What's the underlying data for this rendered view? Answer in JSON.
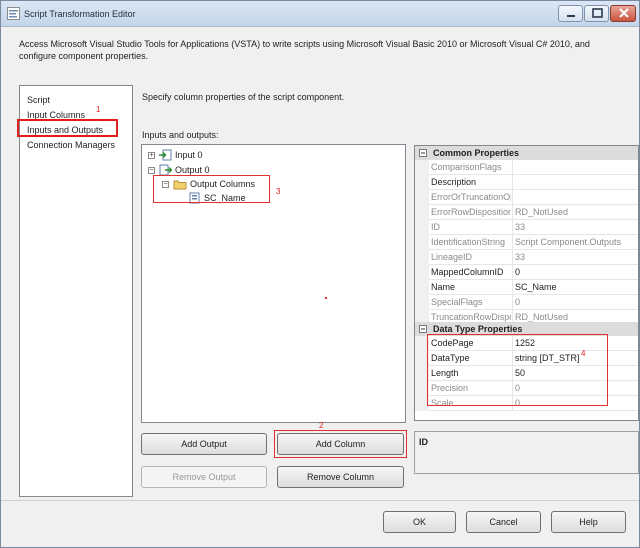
{
  "window": {
    "title": "Script Transformation Editor",
    "description": "Access Microsoft Visual Studio Tools for Applications (VSTA) to write scripts using Microsoft Visual Basic 2010 or Microsoft Visual C# 2010, and configure component properties."
  },
  "nav": {
    "items": [
      "Script",
      "Input Columns",
      "Inputs and Outputs",
      "Connection Managers"
    ],
    "selected": "Inputs and Outputs"
  },
  "main": {
    "description": "Specify column properties of the script component.",
    "tree_label": "Inputs and outputs:"
  },
  "tree": {
    "input": "Input 0",
    "output": "Output 0",
    "output_columns": "Output Columns",
    "column": "SC_Name"
  },
  "annotations": [
    "1",
    "2",
    "3",
    "4"
  ],
  "properties": {
    "common_header": "Common Properties",
    "datatype_header": "Data Type Properties",
    "common": [
      {
        "name": "ComparisonFlags",
        "value": "",
        "disabled": true
      },
      {
        "name": "Description",
        "value": "",
        "disabled": false
      },
      {
        "name": "ErrorOrTruncationOperation",
        "value": "",
        "disabled": true
      },
      {
        "name": "ErrorRowDisposition",
        "value": "RD_NotUsed",
        "disabled": true
      },
      {
        "name": "ID",
        "value": "33",
        "disabled": true
      },
      {
        "name": "IdentificationString",
        "value": "Script Component.Outputs",
        "disabled": true
      },
      {
        "name": "LineageID",
        "value": "33",
        "disabled": true
      },
      {
        "name": "MappedColumnID",
        "value": "0",
        "disabled": false
      },
      {
        "name": "Name",
        "value": "SC_Name",
        "disabled": false
      },
      {
        "name": "SpecialFlags",
        "value": "0",
        "disabled": true
      },
      {
        "name": "TruncationRowDisposition",
        "value": "RD_NotUsed",
        "disabled": true
      }
    ],
    "datatype": [
      {
        "name": "CodePage",
        "value": "1252",
        "disabled": false
      },
      {
        "name": "DataType",
        "value": "string [DT_STR]",
        "disabled": false
      },
      {
        "name": "Length",
        "value": "50",
        "disabled": false
      },
      {
        "name": "Precision",
        "value": "0",
        "disabled": true
      },
      {
        "name": "Scale",
        "value": "0",
        "disabled": true
      }
    ],
    "id_label": "ID"
  },
  "buttons": {
    "add_output": "Add Output",
    "add_column": "Add Column",
    "remove_output": "Remove Output",
    "remove_column": "Remove Column",
    "ok": "OK",
    "cancel": "Cancel",
    "help": "Help"
  },
  "colors": {
    "annotation_red": "#e01e1e",
    "category_gray": "#dcdcdc"
  }
}
